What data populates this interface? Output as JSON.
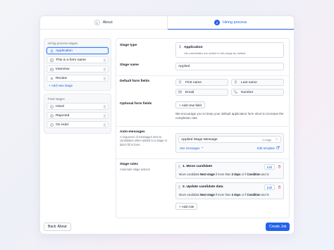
{
  "tabs": [
    {
      "num": "1",
      "label": "About"
    },
    {
      "num": "2",
      "label": "Hiring process"
    }
  ],
  "sidebar": {
    "hiring_title": "Hiring process stages",
    "hiring_items": [
      {
        "label": "Application",
        "icon": "user-icon"
      },
      {
        "label": "This is a form name",
        "icon": "form-icon"
      },
      {
        "label": "Interview",
        "icon": "calendar-icon"
      },
      {
        "label": "Review",
        "icon": "list-icon"
      }
    ],
    "add_stage": "+ Add new stage",
    "final_title": "Final stages",
    "final_items": [
      {
        "label": "Hired",
        "icon": "check-circle-icon"
      },
      {
        "label": "Rejected",
        "icon": "x-circle-icon"
      },
      {
        "label": "On Hold",
        "icon": "clock-icon"
      }
    ]
  },
  "stage_type": {
    "label": "Stage type",
    "value": "Application",
    "desc": "Job-candidates are added to this stage by default."
  },
  "stage_name": {
    "label": "Stage name",
    "value": "Applied"
  },
  "default_fields": {
    "label": "Default form fields",
    "fields": [
      "First name",
      "Last name",
      "Email",
      "Number"
    ]
  },
  "optional_fields": {
    "label": "Optional form fields",
    "add_button": "+ Add new field",
    "note": "We encourage you to keep your default application form short to increase the completion rate."
  },
  "auto_messages": {
    "label": "Auto-messages",
    "desc": "A sequence of messages sent to candidates when added to a stage or didn't fill in form.",
    "message_title": "Applied Stage Message",
    "message_count": "2 msgs",
    "see_messages": "See messages",
    "edit_template": "Edit template"
  },
  "stage_rules": {
    "label": "Stage rules",
    "desc": "Automate stage actions",
    "rules": [
      {
        "title": "1. Move candidate",
        "d1": "Move candidate",
        "d2": "Next stage",
        "d3": " if more than ",
        "d4": "3 days",
        "d5": " or if ",
        "d6": "Condition",
        "d7": " and is"
      },
      {
        "title": "2. Update candidate data",
        "d1": "Move candidate",
        "d2": "Next stage",
        "d3": " if more than ",
        "d4": "3 days",
        "d5": " or if ",
        "d6": "Condition",
        "d7": " and is"
      }
    ],
    "edit_label": "Edit",
    "add_rule": "+ Add rule"
  },
  "footer": {
    "back": "Back: About",
    "create": "Create Job"
  },
  "colors": {
    "accent": "#2563eb",
    "danger": "#dc2626"
  }
}
